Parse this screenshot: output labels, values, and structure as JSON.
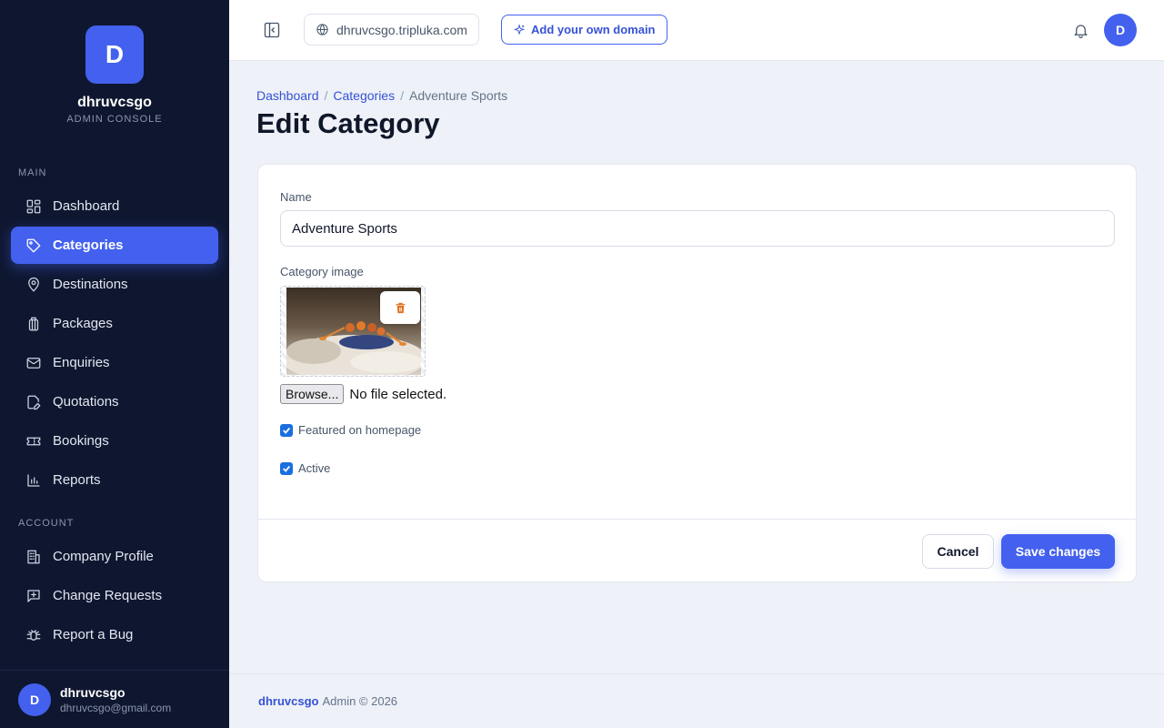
{
  "brand": {
    "initial": "D",
    "name": "dhruvcsgo",
    "subtitle": "ADMIN CONSOLE"
  },
  "sidebar": {
    "main_label": "MAIN",
    "main_items": [
      {
        "label": "Dashboard",
        "icon": "dashboard-grid-icon"
      },
      {
        "label": "Categories",
        "icon": "tag-icon",
        "active": true
      },
      {
        "label": "Destinations",
        "icon": "map-pin-icon"
      },
      {
        "label": "Packages",
        "icon": "luggage-icon"
      },
      {
        "label": "Enquiries",
        "icon": "mail-icon"
      },
      {
        "label": "Quotations",
        "icon": "edit-document-icon"
      },
      {
        "label": "Bookings",
        "icon": "ticket-icon"
      },
      {
        "label": "Reports",
        "icon": "bar-chart-icon"
      }
    ],
    "account_label": "ACCOUNT",
    "account_items": [
      {
        "label": "Company Profile",
        "icon": "building-icon"
      },
      {
        "label": "Change Requests",
        "icon": "message-plus-icon"
      },
      {
        "label": "Report a Bug",
        "icon": "bug-icon"
      }
    ],
    "user": {
      "initial": "D",
      "name": "dhruvcsgo",
      "email": "dhruvcsgo@gmail.com"
    }
  },
  "topbar": {
    "domain": "dhruvcsgo.tripluka.com",
    "add_domain_label": "Add your own domain",
    "avatar_initial": "D"
  },
  "breadcrumb": {
    "items": [
      "Dashboard",
      "Categories",
      "Adventure Sports"
    ],
    "separator": "/"
  },
  "page_title": "Edit Category",
  "form": {
    "name_label": "Name",
    "name_value": "Adventure Sports",
    "image_label": "Category image",
    "browse_label": "Browse...",
    "no_file_text": "No file selected.",
    "featured_label": "Featured on homepage",
    "featured_checked": true,
    "active_label": "Active",
    "active_checked": true,
    "cancel_label": "Cancel",
    "save_label": "Save changes"
  },
  "footer": {
    "brand": "dhruvcsgo",
    "text": "Admin © 2026"
  },
  "colors": {
    "accent": "#4361ee",
    "sidebar_bg": "#0f1730",
    "page_bg": "#eef1f7",
    "trash": "#e0711f",
    "checkbox": "#1a6fe0"
  }
}
